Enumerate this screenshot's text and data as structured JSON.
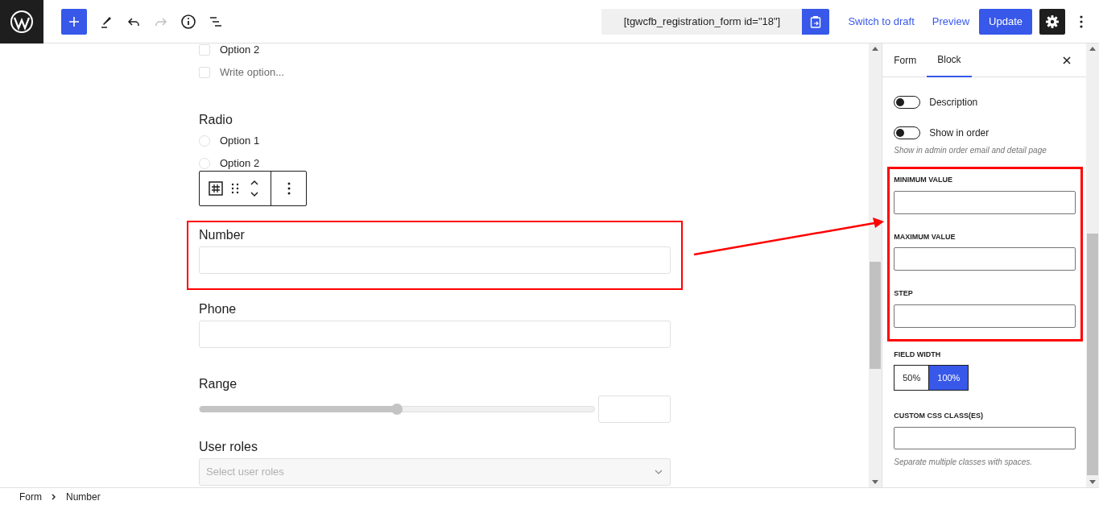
{
  "header": {
    "shortcode": "[tgwcfb_registration_form id=\"18\"]",
    "links": [
      "Switch to draft",
      "Preview"
    ],
    "primary": "Update",
    "redo_disabled": true,
    "settings_open": true
  },
  "canvas": {
    "checkbox_options": [
      {
        "kind": "option",
        "text": "Option 2",
        "checked": false
      },
      {
        "kind": "new",
        "text": "Write option...",
        "checked": false
      }
    ],
    "fields": [
      {
        "kind": "radio",
        "label": "Radio",
        "options": [
          "Option 1",
          "Option 2"
        ],
        "highlighted": false
      },
      {
        "kind": "block_toolbar"
      },
      {
        "kind": "text",
        "label": "Number",
        "highlighted": true
      },
      {
        "kind": "text",
        "label": "Phone",
        "highlighted": false
      },
      {
        "kind": "range",
        "label": "Range",
        "level": 0.5,
        "highlighted": false
      },
      {
        "kind": "select",
        "label": "User roles",
        "placeholder": "Select user roles",
        "highlighted": false
      }
    ]
  },
  "sidebar": {
    "tabs": [
      {
        "label": "Form",
        "selected": false
      },
      {
        "label": "Block",
        "selected": true
      }
    ],
    "toggles": [
      {
        "label": "Description",
        "on": false
      },
      {
        "label": "Show in order",
        "on": false,
        "help": "Show in admin order email and detail page"
      }
    ],
    "limits": {
      "highlighted": true,
      "fields": [
        "MINIMUM VALUE",
        "MAXIMUM VALUE",
        "STEP"
      ]
    },
    "field_width": {
      "label": "FIELD WIDTH",
      "options": [
        {
          "label": "50%",
          "selected": false
        },
        {
          "label": "100%",
          "selected": true
        }
      ]
    },
    "css_class": {
      "label": "CUSTOM CSS CLASS(ES)",
      "help": "Separate multiple classes with spaces."
    }
  },
  "breadcrumb": [
    "Form",
    "Number"
  ]
}
